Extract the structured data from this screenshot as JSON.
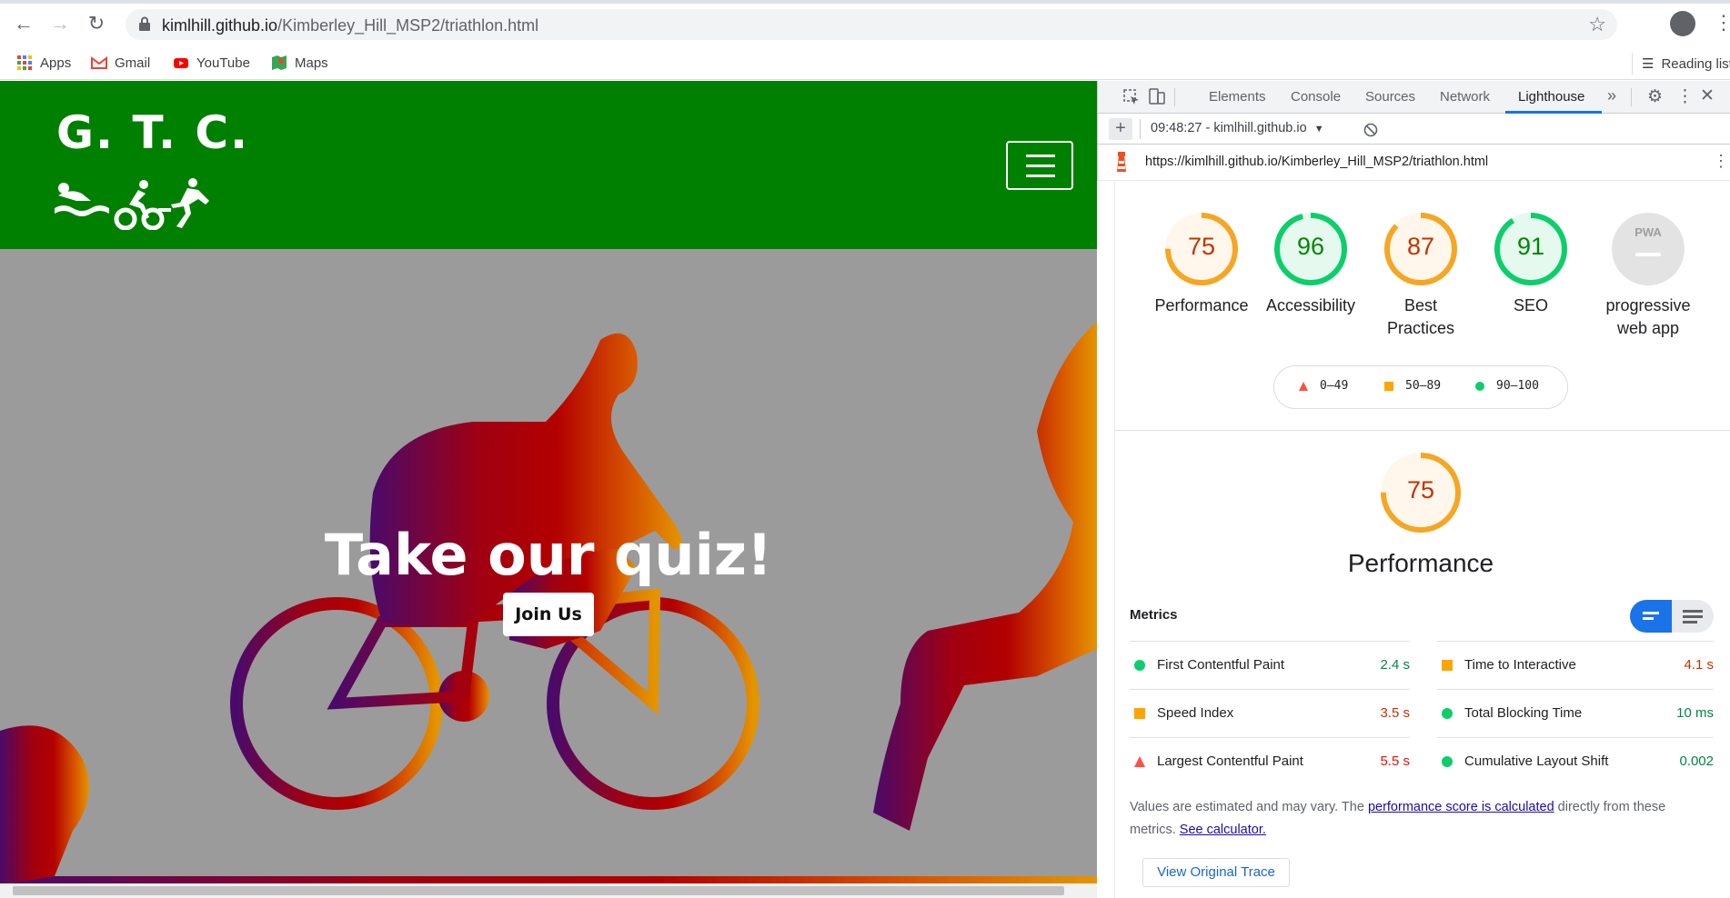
{
  "browser": {
    "url_host": "kimlhill.github.io",
    "url_path": "/Kimberley_Hill_MSP2/triathlon.html",
    "bookmarks": [
      {
        "label": "Apps",
        "icon": "apps-grid-icon"
      },
      {
        "label": "Gmail",
        "icon": "gmail-icon"
      },
      {
        "label": "YouTube",
        "icon": "youtube-icon"
      },
      {
        "label": "Maps",
        "icon": "maps-icon"
      }
    ],
    "reading_list": "Reading list"
  },
  "site": {
    "logo_text": "G. T. C.",
    "hero_title": "Take our quiz!",
    "join_button": "Join Us",
    "colors": {
      "header": "#008000",
      "hero_bg": "#9b9b9b"
    }
  },
  "devtools": {
    "tabs": [
      "Elements",
      "Console",
      "Sources",
      "Network",
      "Lighthouse"
    ],
    "active_tab": "Lighthouse",
    "more_tabs": "»",
    "report_selector": "09:48:27 - kimlhill.github.io",
    "report_url": "https://kimlhill.github.io/Kimberley_Hill_MSP2/triathlon.html",
    "scores": [
      {
        "value": "75",
        "label": "Performance",
        "color": "#f5a623",
        "text_color": "#c33300",
        "fill": "#fff7eb"
      },
      {
        "value": "96",
        "label": "Accessibility",
        "color": "#0cce6b",
        "text_color": "#008800",
        "fill": "#e6f9ee"
      },
      {
        "value": "87",
        "label": "Best Practices",
        "color": "#f5a623",
        "text_color": "#c33300",
        "fill": "#fff7eb"
      },
      {
        "value": "91",
        "label": "SEO",
        "color": "#0cce6b",
        "text_color": "#008800",
        "fill": "#e6f9ee"
      },
      {
        "value": "PWA",
        "label": "progressive web app",
        "color": "#e0e0e0",
        "text_color": "#9e9e9e",
        "fill": "#e0e0e0"
      }
    ],
    "legend": [
      {
        "range": "0–49",
        "shape": "triangle",
        "color": "#ff4e42"
      },
      {
        "range": "50–89",
        "shape": "square",
        "color": "#ffa400"
      },
      {
        "range": "90–100",
        "shape": "circle",
        "color": "#0cce6b"
      }
    ],
    "performance": {
      "score": "75",
      "title": "Performance"
    },
    "metrics_title": "Metrics",
    "metrics": [
      {
        "name": "First Contentful Paint",
        "value": "2.4 s",
        "status": "good"
      },
      {
        "name": "Time to Interactive",
        "value": "4.1 s",
        "status": "average"
      },
      {
        "name": "Speed Index",
        "value": "3.5 s",
        "status": "average"
      },
      {
        "name": "Total Blocking Time",
        "value": "10 ms",
        "status": "good"
      },
      {
        "name": "Largest Contentful Paint",
        "value": "5.5 s",
        "status": "fail"
      },
      {
        "name": "Cumulative Layout Shift",
        "value": "0.002",
        "status": "good"
      }
    ],
    "note": {
      "prefix": "Values are estimated and may vary. The ",
      "link1": "performance score is calculated",
      "middle": " directly from these metrics. ",
      "link2": "See calculator."
    },
    "trace_button": "View Original Trace"
  }
}
